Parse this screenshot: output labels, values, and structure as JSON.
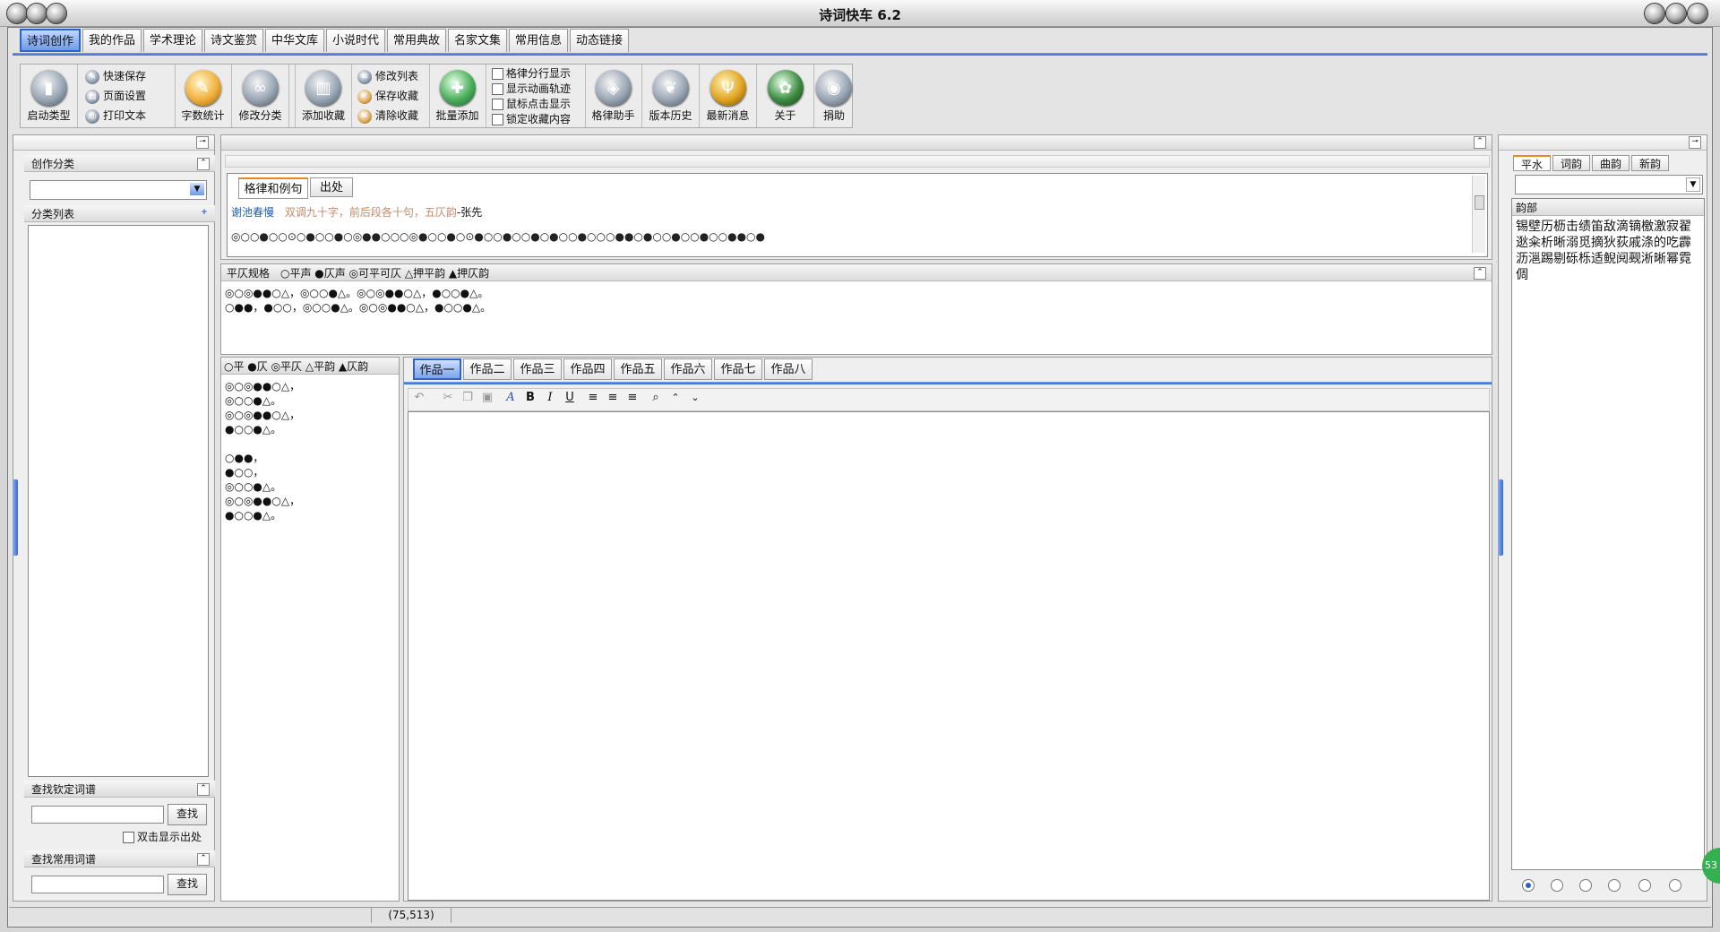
{
  "window": {
    "title": "诗词快车 6.2"
  },
  "menu_tabs": [
    "诗词创作",
    "我的作品",
    "学术理论",
    "诗文鉴赏",
    "中华文库",
    "小说时代",
    "常用典故",
    "名家文集",
    "常用信息",
    "动态链接"
  ],
  "ribbon": {
    "launch_type": "启动类型",
    "quick_save": "快速保存",
    "page_setup": "页面设置",
    "print_text": "打印文本",
    "word_count": "字数统计",
    "edit_category": "修改分类",
    "add_favorite": "添加收藏",
    "edit_list": "修改列表",
    "save_favorite": "保存收藏",
    "clear_favorite": "清除收藏",
    "batch_add": "批量添加",
    "checkboxes": [
      "格律分行显示",
      "显示动画轨迹",
      "鼠标点击显示",
      "锁定收藏内容"
    ],
    "meter_helper": "格律助手",
    "version_history": "版本历史",
    "latest_news": "最新消息",
    "about": "关于",
    "donate": "捐助"
  },
  "left": {
    "category_header": "创作分类",
    "list_header": "分类列表",
    "search_ci_header": "查找钦定词谱",
    "search_ci_button": "查找",
    "double_click_label": "双击显示出处",
    "search_common_header": "查找常用词谱",
    "search_common_button": "查找"
  },
  "center": {
    "tabs": [
      "格律和例句",
      "出处"
    ],
    "example_title": "谢池春慢",
    "example_desc": "双调九十字，前后段各十句，五仄韵",
    "example_author": "-张先",
    "example_pattern": "◎○○●○○⊙○●○○●○◎●●○○○◎●○○●○⊙●○○●○○●○●○○●○○○●●○●○○●○○●○○●●○●",
    "rules_header": "平仄规格　○平声 ●仄声 ◎可平可仄 △押平韵 ▲押仄韵",
    "rules_lines": [
      "◎○◎●●○△，◎○○●△。◎○◎●●○△，●○○●△。",
      "○●●，●○○，◎○○●△。◎○◎●●○△，●○○●△。"
    ],
    "legend": "○平 ●仄 ◎平仄 △平韵 ▲仄韵",
    "pattern_lines": [
      "◎○◎●●○△，",
      "◎○○●△。",
      "◎○◎●●○△，",
      "●○○●△。",
      "",
      "○●●，",
      "●○○，",
      "◎○○●△。",
      "◎○◎●●○△，",
      "●○○●△。"
    ],
    "work_tabs": [
      "作品一",
      "作品二",
      "作品三",
      "作品四",
      "作品五",
      "作品六",
      "作品七",
      "作品八"
    ],
    "editor_text": ""
  },
  "right": {
    "rhyme_tabs": [
      "平水",
      "词韵",
      "曲韵",
      "新韵"
    ],
    "rhyme_header": "韵部",
    "rhyme_text": "锡壁历枥击绩笛敌滴镝檄激寂翟逖籴析晰溺觅摘狄荻戚涤的吃霹沥㴩踢剔砾栎适鲵阋觋淅晰幂霓倜",
    "badge": "53"
  },
  "status": {
    "coords": "(75,513)"
  }
}
